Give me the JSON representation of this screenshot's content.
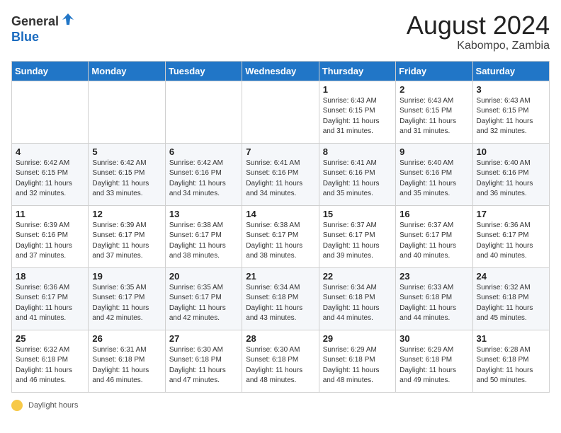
{
  "header": {
    "logo_general": "General",
    "logo_blue": "Blue",
    "month_year": "August 2024",
    "location": "Kabompo, Zambia"
  },
  "days_of_week": [
    "Sunday",
    "Monday",
    "Tuesday",
    "Wednesday",
    "Thursday",
    "Friday",
    "Saturday"
  ],
  "weeks": [
    [
      {
        "day": "",
        "detail": ""
      },
      {
        "day": "",
        "detail": ""
      },
      {
        "day": "",
        "detail": ""
      },
      {
        "day": "",
        "detail": ""
      },
      {
        "day": "1",
        "detail": "Sunrise: 6:43 AM\nSunset: 6:15 PM\nDaylight: 11 hours\nand 31 minutes."
      },
      {
        "day": "2",
        "detail": "Sunrise: 6:43 AM\nSunset: 6:15 PM\nDaylight: 11 hours\nand 31 minutes."
      },
      {
        "day": "3",
        "detail": "Sunrise: 6:43 AM\nSunset: 6:15 PM\nDaylight: 11 hours\nand 32 minutes."
      }
    ],
    [
      {
        "day": "4",
        "detail": "Sunrise: 6:42 AM\nSunset: 6:15 PM\nDaylight: 11 hours\nand 32 minutes."
      },
      {
        "day": "5",
        "detail": "Sunrise: 6:42 AM\nSunset: 6:15 PM\nDaylight: 11 hours\nand 33 minutes."
      },
      {
        "day": "6",
        "detail": "Sunrise: 6:42 AM\nSunset: 6:16 PM\nDaylight: 11 hours\nand 34 minutes."
      },
      {
        "day": "7",
        "detail": "Sunrise: 6:41 AM\nSunset: 6:16 PM\nDaylight: 11 hours\nand 34 minutes."
      },
      {
        "day": "8",
        "detail": "Sunrise: 6:41 AM\nSunset: 6:16 PM\nDaylight: 11 hours\nand 35 minutes."
      },
      {
        "day": "9",
        "detail": "Sunrise: 6:40 AM\nSunset: 6:16 PM\nDaylight: 11 hours\nand 35 minutes."
      },
      {
        "day": "10",
        "detail": "Sunrise: 6:40 AM\nSunset: 6:16 PM\nDaylight: 11 hours\nand 36 minutes."
      }
    ],
    [
      {
        "day": "11",
        "detail": "Sunrise: 6:39 AM\nSunset: 6:16 PM\nDaylight: 11 hours\nand 37 minutes."
      },
      {
        "day": "12",
        "detail": "Sunrise: 6:39 AM\nSunset: 6:17 PM\nDaylight: 11 hours\nand 37 minutes."
      },
      {
        "day": "13",
        "detail": "Sunrise: 6:38 AM\nSunset: 6:17 PM\nDaylight: 11 hours\nand 38 minutes."
      },
      {
        "day": "14",
        "detail": "Sunrise: 6:38 AM\nSunset: 6:17 PM\nDaylight: 11 hours\nand 38 minutes."
      },
      {
        "day": "15",
        "detail": "Sunrise: 6:37 AM\nSunset: 6:17 PM\nDaylight: 11 hours\nand 39 minutes."
      },
      {
        "day": "16",
        "detail": "Sunrise: 6:37 AM\nSunset: 6:17 PM\nDaylight: 11 hours\nand 40 minutes."
      },
      {
        "day": "17",
        "detail": "Sunrise: 6:36 AM\nSunset: 6:17 PM\nDaylight: 11 hours\nand 40 minutes."
      }
    ],
    [
      {
        "day": "18",
        "detail": "Sunrise: 6:36 AM\nSunset: 6:17 PM\nDaylight: 11 hours\nand 41 minutes."
      },
      {
        "day": "19",
        "detail": "Sunrise: 6:35 AM\nSunset: 6:17 PM\nDaylight: 11 hours\nand 42 minutes."
      },
      {
        "day": "20",
        "detail": "Sunrise: 6:35 AM\nSunset: 6:17 PM\nDaylight: 11 hours\nand 42 minutes."
      },
      {
        "day": "21",
        "detail": "Sunrise: 6:34 AM\nSunset: 6:18 PM\nDaylight: 11 hours\nand 43 minutes."
      },
      {
        "day": "22",
        "detail": "Sunrise: 6:34 AM\nSunset: 6:18 PM\nDaylight: 11 hours\nand 44 minutes."
      },
      {
        "day": "23",
        "detail": "Sunrise: 6:33 AM\nSunset: 6:18 PM\nDaylight: 11 hours\nand 44 minutes."
      },
      {
        "day": "24",
        "detail": "Sunrise: 6:32 AM\nSunset: 6:18 PM\nDaylight: 11 hours\nand 45 minutes."
      }
    ],
    [
      {
        "day": "25",
        "detail": "Sunrise: 6:32 AM\nSunset: 6:18 PM\nDaylight: 11 hours\nand 46 minutes."
      },
      {
        "day": "26",
        "detail": "Sunrise: 6:31 AM\nSunset: 6:18 PM\nDaylight: 11 hours\nand 46 minutes."
      },
      {
        "day": "27",
        "detail": "Sunrise: 6:30 AM\nSunset: 6:18 PM\nDaylight: 11 hours\nand 47 minutes."
      },
      {
        "day": "28",
        "detail": "Sunrise: 6:30 AM\nSunset: 6:18 PM\nDaylight: 11 hours\nand 48 minutes."
      },
      {
        "day": "29",
        "detail": "Sunrise: 6:29 AM\nSunset: 6:18 PM\nDaylight: 11 hours\nand 48 minutes."
      },
      {
        "day": "30",
        "detail": "Sunrise: 6:29 AM\nSunset: 6:18 PM\nDaylight: 11 hours\nand 49 minutes."
      },
      {
        "day": "31",
        "detail": "Sunrise: 6:28 AM\nSunset: 6:18 PM\nDaylight: 11 hours\nand 50 minutes."
      }
    ]
  ],
  "legend": {
    "daylight_label": "Daylight hours"
  }
}
